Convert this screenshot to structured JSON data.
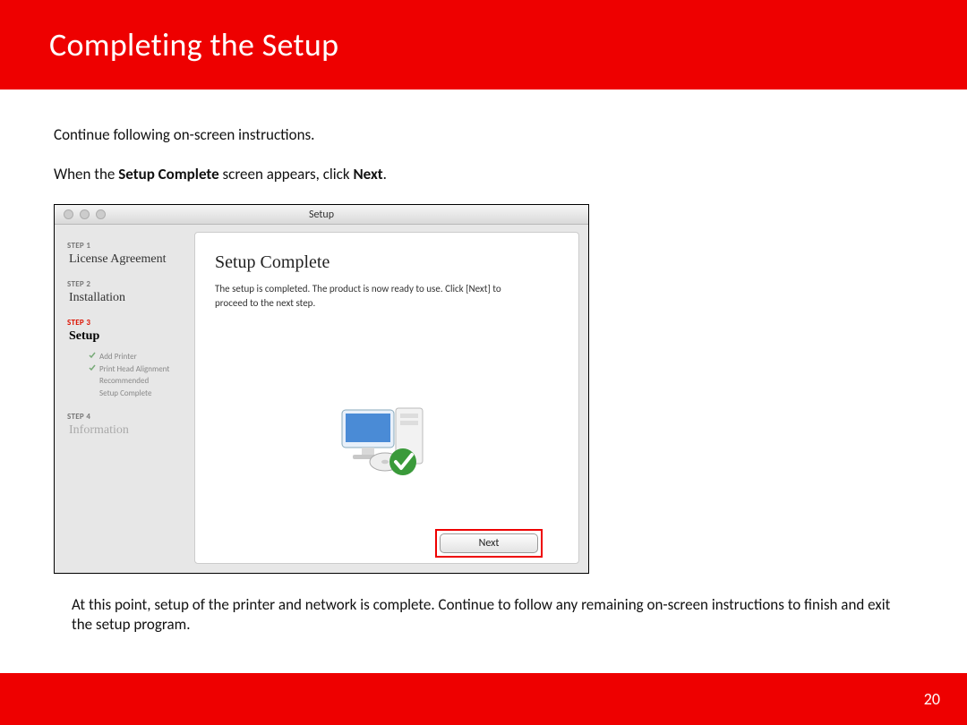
{
  "header": {
    "title": "Completing the Setup"
  },
  "body": {
    "line1": "Continue following on-screen instructions.",
    "line2_a": "When the  ",
    "line2_b": "Setup Complete",
    "line2_c": " screen appears, click ",
    "line2_d": "Next",
    "line2_e": "."
  },
  "window": {
    "title": "Setup",
    "steps": [
      {
        "label": "STEP 1",
        "title": "License Agreement"
      },
      {
        "label": "STEP 2",
        "title": "Installation"
      },
      {
        "label": "STEP 3",
        "title": "Setup"
      },
      {
        "label": "STEP 4",
        "title": "Information"
      }
    ],
    "substeps": [
      "Add Printer",
      "Print Head Alignment Recommended",
      "Setup Complete"
    ],
    "content": {
      "heading": "Setup Complete",
      "desc": "The setup is completed. The product is now ready to use. Click [Next] to proceed to the next step."
    },
    "next_label": "Next"
  },
  "after": "At this point, setup of the printer and network is complete.  Continue to follow any remaining on-screen instructions to finish and exit the setup program.",
  "footer": {
    "page": "20"
  }
}
